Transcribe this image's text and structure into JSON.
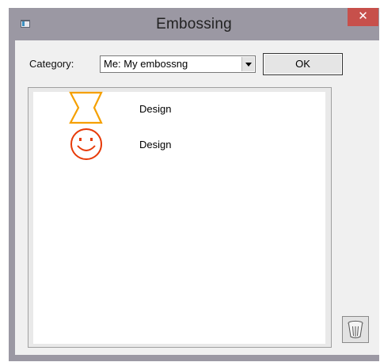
{
  "window": {
    "title": "Embossing",
    "close_glyph": "✕"
  },
  "toolbar": {
    "category_label": "Category:",
    "category_value": "Me: My embossng",
    "ok_label": "OK"
  },
  "list": {
    "items": [
      {
        "label": "Design",
        "icon": "hourglass-emboss-icon",
        "color": "#f5a000"
      },
      {
        "label": "Design",
        "icon": "smiley-emboss-icon",
        "color": "#e73a08"
      }
    ]
  },
  "icons": {
    "app": "app-window-icon",
    "dropdown": "chevron-down-icon",
    "trash": "trash-icon"
  }
}
